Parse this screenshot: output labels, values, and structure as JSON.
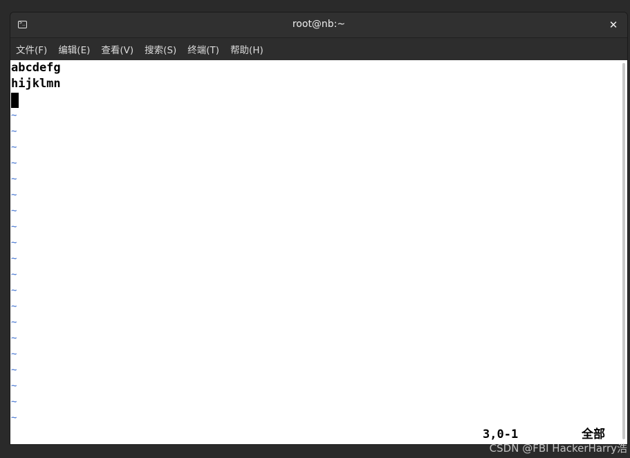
{
  "window": {
    "title": "root@nb:~",
    "close_label": "✕"
  },
  "menu": {
    "items": [
      {
        "label": "文件(F)"
      },
      {
        "label": "编辑(E)"
      },
      {
        "label": "查看(V)"
      },
      {
        "label": "搜索(S)"
      },
      {
        "label": "终端(T)"
      },
      {
        "label": "帮助(H)"
      }
    ]
  },
  "editor": {
    "lines": [
      "abcdefg",
      "hijklmn"
    ],
    "empty_line_marker": "~",
    "status_position": "3,0-1",
    "status_scope": "全部"
  },
  "watermark": "CSDN @FBI HackerHarry浩",
  "colors": {
    "tilde": "#3d6fcf",
    "background": "#ffffff",
    "text": "#000000"
  }
}
